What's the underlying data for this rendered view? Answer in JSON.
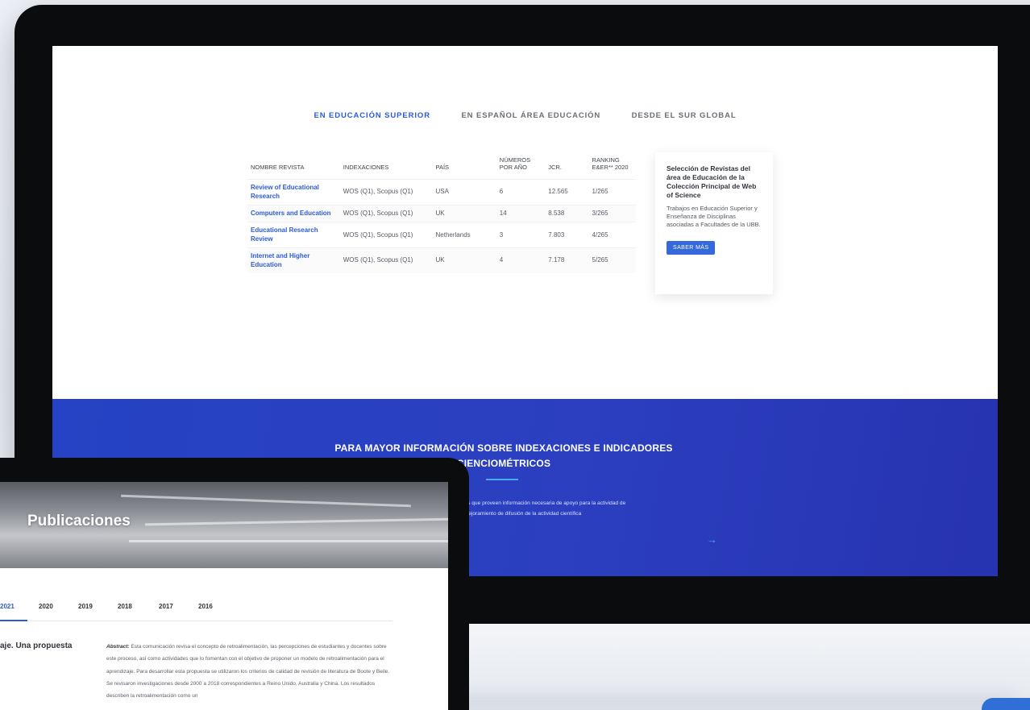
{
  "desktop": {
    "tabs": [
      {
        "label": "EN EDUCACIÓN SUPERIOR",
        "active": true
      },
      {
        "label": "EN ESPAÑOL ÁREA EDUCACIÓN",
        "active": false
      },
      {
        "label": "DESDE EL SUR GLOBAL",
        "active": false
      }
    ],
    "table": {
      "headers": {
        "name": "NOMBRE REVISTA",
        "indexing": "INDEXACIONES",
        "country": "PAÍS",
        "issues": "NÚMEROS POR AÑO",
        "jcr": "JCR.",
        "ranking": "RANKING E&ER** 2020"
      },
      "rows": [
        {
          "name": "Review of Educational Research",
          "indexing": "WOS (Q1), Scopus (Q1)",
          "country": "USA",
          "issues": "6",
          "jcr": "12.565",
          "ranking": "1/265"
        },
        {
          "name": "Computers and Education",
          "indexing": "WOS (Q1), Scopus (Q1)",
          "country": "UK",
          "issues": "14",
          "jcr": "8.538",
          "ranking": "3/265"
        },
        {
          "name": "Educational Research Review",
          "indexing": "WOS (Q1), Scopus (Q1)",
          "country": "Netherlands",
          "issues": "3",
          "jcr": "7.803",
          "ranking": "4/265"
        },
        {
          "name": "Internet and Higher Education",
          "indexing": "WOS (Q1), Scopus (Q1)",
          "country": "UK",
          "issues": "4",
          "jcr": "7.178",
          "ranking": "5/265"
        }
      ]
    },
    "card": {
      "title": "Selección de Revistas del área de Educación de la Colección Principal de Web of Science",
      "text": "Trabajos en Educación Superior y Enseñanza de Disciplinas asociadas a Facultades de la UBB.",
      "button": "SABER MÁS"
    },
    "banner": {
      "title_line1": "PARA MAYOR INFORMACIÓN SOBRE INDEXACIONES E INDICADORES",
      "title_line2": "CIENCIOMÉTRICOS",
      "text_line1": "elementos que proveen información necesaria de apoyo para la actividad de",
      "text_line2": "ación y mejoramiento de difusión de la actividad científica",
      "arrow": "→"
    }
  },
  "laptop": {
    "hero_title": "Publicaciones",
    "years": [
      {
        "label": "2021",
        "active": true
      },
      {
        "label": "2020",
        "active": false
      },
      {
        "label": "2019",
        "active": false
      },
      {
        "label": "2018",
        "active": false
      },
      {
        "label": "2017",
        "active": false
      },
      {
        "label": "2016",
        "active": false
      }
    ],
    "pub_title": "aje. Una propuesta",
    "abstract_label": "Abstract:",
    "abstract_text": "Esta comunicación revisa el concepto de retroalimentación, las percepciones de estudiantes y docentes sobre este proceso, así como actividades que lo fomentan con el objetivo de proponer un modelo de retroalimentación para el aprendizaje. Para desarrollar esta propuesta se utilizaron los criterios de calidad de revisión de literatura de Boote y Beile. Se revisaron investigaciones desde 2000 a 2018 correspondientes a Reino Unido, Australia y China. Los resultados describen la retroalimentación como un"
  },
  "colors": {
    "accent": "#2d5bd6",
    "banner": "#2840c0",
    "bezel": "#0b0c0e"
  }
}
